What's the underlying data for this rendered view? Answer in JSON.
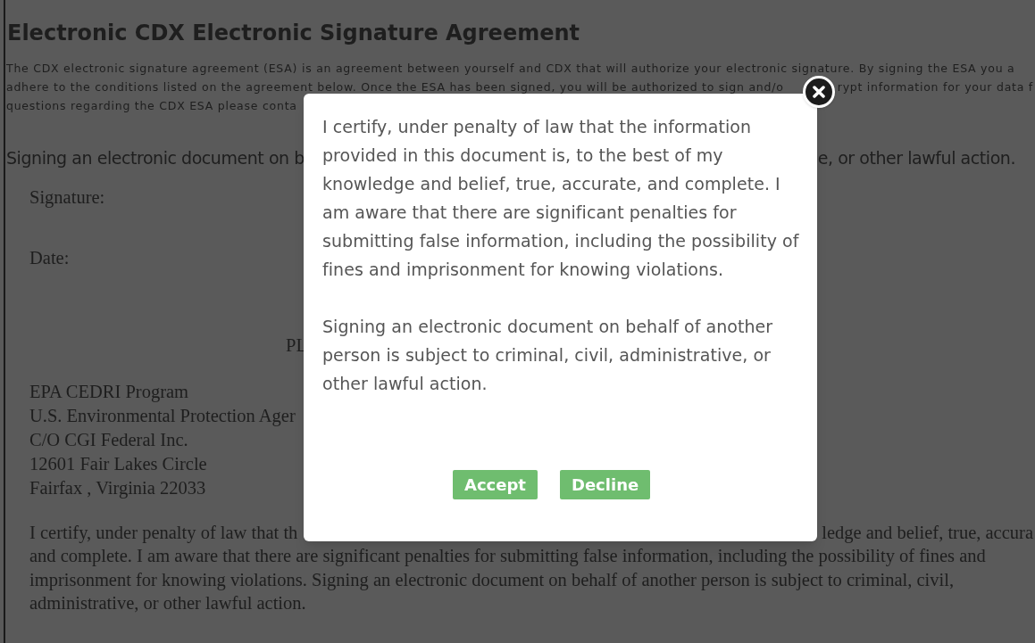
{
  "page": {
    "title": "Electronic CDX Electronic Signature Agreement",
    "intro": [
      {
        "left": "The CDX electronic signature agreement (ESA) is an agreement between yourself and CDX that will authorize your electronic signature. By signing the ESA you a"
      },
      {
        "left": "adhere to the conditions listed on the agreement below. Once the ESA has been signed, you will be authorized to sign and/o",
        "right": "rypt information for your data f"
      },
      {
        "left": "questions regarding the CDX ESA please conta"
      }
    ],
    "signing_line": {
      "left": "Signing an electronic document on b",
      "right": "e, or other lawful action."
    },
    "signature_label": "Signature:",
    "date_label": "Date:",
    "heading_fragment": "PL",
    "address": [
      "EPA CEDRI Program",
      "U.S. Environmental Protection Ager",
      "C/O CGI Federal Inc.",
      "12601 Fair Lakes Circle",
      "Fairfax , Virginia 22033"
    ],
    "certification": [
      {
        "left": "I certify, under penalty of law that th",
        "right": "ledge and belief, true, accura"
      },
      {
        "left": "and complete. I am aware that there are significant penalties for submitting false information, including the possibility of fines and"
      },
      {
        "left": "imprisonment for knowing violations. Signing an electronic document on behalf of another person is subject to criminal, civil,"
      },
      {
        "left": "administrative, or other lawful action."
      }
    ]
  },
  "modal": {
    "paragraphs": [
      "I certify, under penalty of law that the information provided in this document is, to the best of my knowledge and belief, true, accurate, and complete. I am aware that there are significant penalties for submitting false information, including the possibility of fines and imprisonment for knowing violations.",
      "Signing an electronic document on behalf of another person is subject to criminal, civil, administrative, or other lawful action."
    ],
    "buttons": [
      {
        "label": "Accept"
      },
      {
        "label": "Decline"
      }
    ]
  }
}
